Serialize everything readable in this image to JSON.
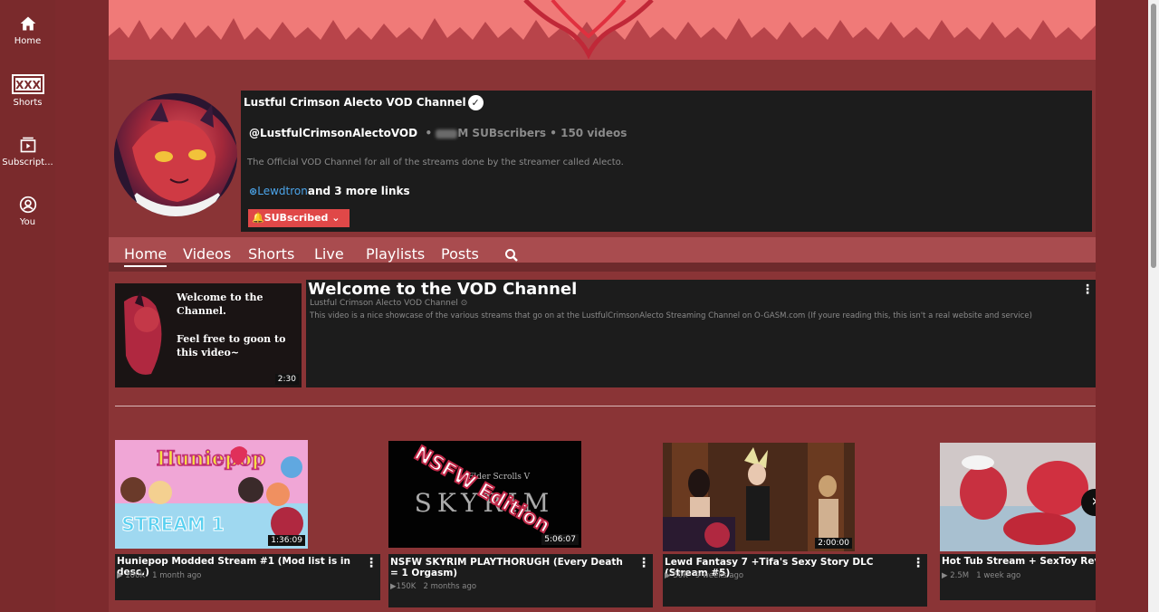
{
  "nav": {
    "items": [
      {
        "label": "Home",
        "icon": "home-icon"
      },
      {
        "label": "Shorts",
        "icon": "xxx-icon"
      },
      {
        "label": "Subscript...",
        "icon": "subscriptions-icon"
      },
      {
        "label": "You",
        "icon": "you-icon"
      }
    ]
  },
  "channel": {
    "title": "Lustful Crimson Alecto VOD Channel",
    "handle": "@LustfulCrimsonAlectoVOD",
    "subscribers": "M SUBscribers",
    "videos": "150 videos",
    "description": "The Official VOD Channel for all of the streams done by the streamer called Alecto.",
    "link_label": "Lewdtron",
    "more_links": "and 3 more links",
    "subscribe_label": "SUBscribed"
  },
  "tabs": [
    "Home",
    "Videos",
    "Shorts",
    "Live",
    "Playlists",
    "Posts"
  ],
  "featured": {
    "thumb_line1": "Welcome to the",
    "thumb_line2": "Channel.",
    "thumb_line3": "Feel free to goon to",
    "thumb_line4": "this video~",
    "duration": "2:30",
    "title": "Welcome to the VOD Channel",
    "channel": "Lustful Crimson Alecto VOD Channel",
    "description": "This video is a nice showcase of the various streams that go on at the LustfulCrimsonAlecto Streaming Channel on O-GASM.com (If youre reading this, this isn't a real website and service)"
  },
  "videos": [
    {
      "title": "Huniepop Modded Stream #1 (Mod list is in desc.)",
      "views": "100K",
      "age": "1 month ago",
      "duration": "1:36:09",
      "thumb_text": "Huniepop",
      "thumb_sub": "STREAM 1"
    },
    {
      "title": "NSFW SKYRIM PLAYTHORUGH (Every Death = 1 Orgasm)",
      "views": "150K",
      "age": "2 months ago",
      "duration": "5:06:07",
      "thumb_text": "NSFW Edition",
      "thumb_sub": "SKYRIM",
      "thumb_top": "Elder Scrolls V"
    },
    {
      "title": "Lewd Fantasy 7 +Tifa's Sexy Story DLC (Stream #5)",
      "views": "50K",
      "age": "9 weeks ago",
      "duration": "2:00:00"
    },
    {
      "title": "Hot Tub Stream + SexToy Review (S",
      "views": "2.5M",
      "age": "1 week ago"
    }
  ],
  "colors": {
    "accent": "#e04848",
    "banner": "#f07a78",
    "page": "#8a3436"
  }
}
